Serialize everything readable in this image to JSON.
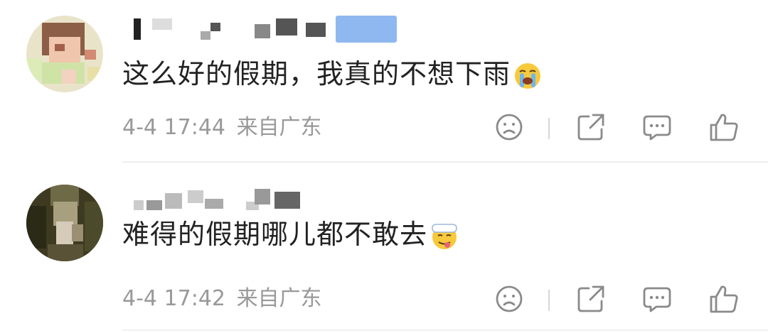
{
  "comments": [
    {
      "text": "这么好的假期，我真的不想下雨",
      "emoji_icon": "loudly-crying-face-icon",
      "date": "4-4",
      "time": "17:44",
      "location": "来自广东"
    },
    {
      "text": "难得的假期哪儿都不敢去",
      "emoji_icon": "tongue-out-face-with-bandage-icon",
      "date": "4-4",
      "time": "17:42",
      "location": "来自广东"
    }
  ],
  "action_icons": [
    "dislike-face-icon",
    "share-icon",
    "reply-comment-icon",
    "like-thumb-icon"
  ],
  "colors": {
    "text": "#222222",
    "meta": "#999999",
    "icon": "#8a8a8a",
    "badge_blur": "#8fb8f0"
  }
}
